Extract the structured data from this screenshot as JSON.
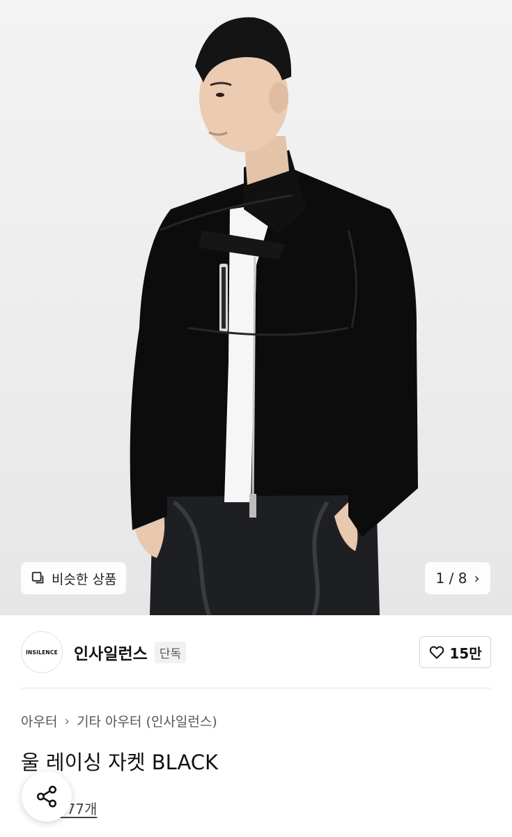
{
  "gallery": {
    "similar_label": "비슷한 상품",
    "pager": "1 / 8"
  },
  "brand": {
    "logo_text": "INSILENCE",
    "name": "인사일런스",
    "badge": "단독",
    "likes": "15만"
  },
  "breadcrumb": {
    "level1": "아우터",
    "level2": "기타 아우터 (인사일런스)"
  },
  "product": {
    "title": "울 레이싱 자켓 BLACK",
    "reviews": "보기 77개"
  },
  "colors": {
    "accent_star": "#f5a623",
    "text": "#111111"
  }
}
